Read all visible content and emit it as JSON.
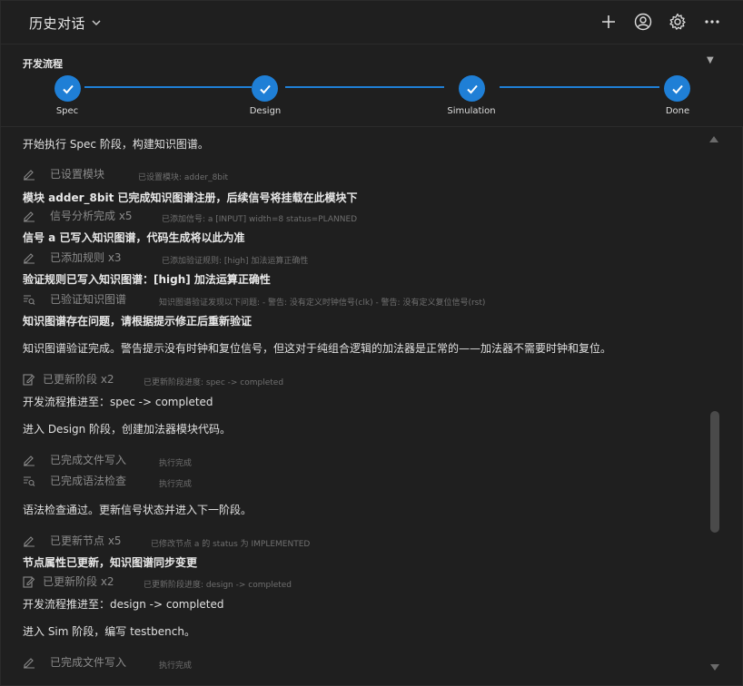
{
  "header": {
    "title": "历史对话",
    "icons": [
      "plus-icon",
      "account-icon",
      "gear-icon",
      "more-icon"
    ]
  },
  "flow": {
    "title": "开发流程",
    "toggle": "▼",
    "steps": [
      {
        "label": "Spec",
        "done": true
      },
      {
        "label": "Design",
        "done": true
      },
      {
        "label": "Simulation",
        "done": true
      },
      {
        "label": "Done",
        "done": true
      }
    ],
    "accent": "#1f7fd6"
  },
  "log": [
    {
      "type": "msg",
      "text": "开始执行 Spec 阶段，构建知识图谱。"
    },
    {
      "type": "tool",
      "icon": "pencil-icon",
      "name": "已设置模块",
      "detail": "已设置模块: adder_8bit"
    },
    {
      "type": "msg",
      "text": "模块 adder_8bit 已完成知识图谱注册，后续信号将挂载在此模块下"
    },
    {
      "type": "tool",
      "icon": "pencil-icon",
      "name": "信号分析完成 x5",
      "detail": "已添加信号: a [INPUT] width=8 status=PLANNED"
    },
    {
      "type": "msg",
      "text": "信号 a 已写入知识图谱，代码生成将以此为准"
    },
    {
      "type": "tool",
      "icon": "pencil-icon",
      "name": "已添加规则 x3",
      "detail": "已添加验证规则: [high] 加法运算正确性"
    },
    {
      "type": "msg",
      "text": "验证规则已写入知识图谱：[high] 加法运算正确性"
    },
    {
      "type": "tool",
      "icon": "search-list-icon",
      "name": "已验证知识图谱",
      "detail": "知识图谱验证发现以下问题: - 警告: 没有定义时钟信号(clk) - 警告: 没有定义复位信号(rst)"
    },
    {
      "type": "msg",
      "text": "知识图谱存在问题，请根据提示修正后重新验证"
    },
    {
      "type": "msg",
      "text": "知识图谱验证完成。警告提示没有时钟和复位信号，但这对于纯组合逻辑的加法器是正常的——加法器不需要时钟和复位。"
    },
    {
      "type": "tool",
      "icon": "edit-doc-icon",
      "name": "已更新阶段 x2",
      "detail": "已更新阶段进度: spec -> completed"
    },
    {
      "type": "msg",
      "text": "开发流程推进至：spec -> completed"
    },
    {
      "type": "msg",
      "text": "进入 Design 阶段，创建加法器模块代码。"
    },
    {
      "type": "tool",
      "icon": "pencil-icon",
      "name": "已完成文件写入",
      "detail": "执行完成"
    },
    {
      "type": "tool",
      "icon": "search-list-icon",
      "name": "已完成语法检查",
      "detail": "执行完成"
    },
    {
      "type": "msg",
      "text": "语法检查通过。更新信号状态并进入下一阶段。"
    },
    {
      "type": "tool",
      "icon": "pencil-icon",
      "name": "已更新节点 x5",
      "detail": "已修改节点 a 的 status 为 IMPLEMENTED"
    },
    {
      "type": "msg",
      "text": "节点属性已更新，知识图谱同步变更"
    },
    {
      "type": "tool",
      "icon": "edit-doc-icon",
      "name": "已更新阶段 x2",
      "detail": "已更新阶段进度: design -> completed"
    },
    {
      "type": "msg",
      "text": "开发流程推进至：design -> completed"
    },
    {
      "type": "msg",
      "text": "进入 Sim 阶段，编写 testbench。"
    },
    {
      "type": "tool",
      "icon": "pencil-icon",
      "name": "已完成文件写入",
      "detail": "执行完成"
    }
  ]
}
